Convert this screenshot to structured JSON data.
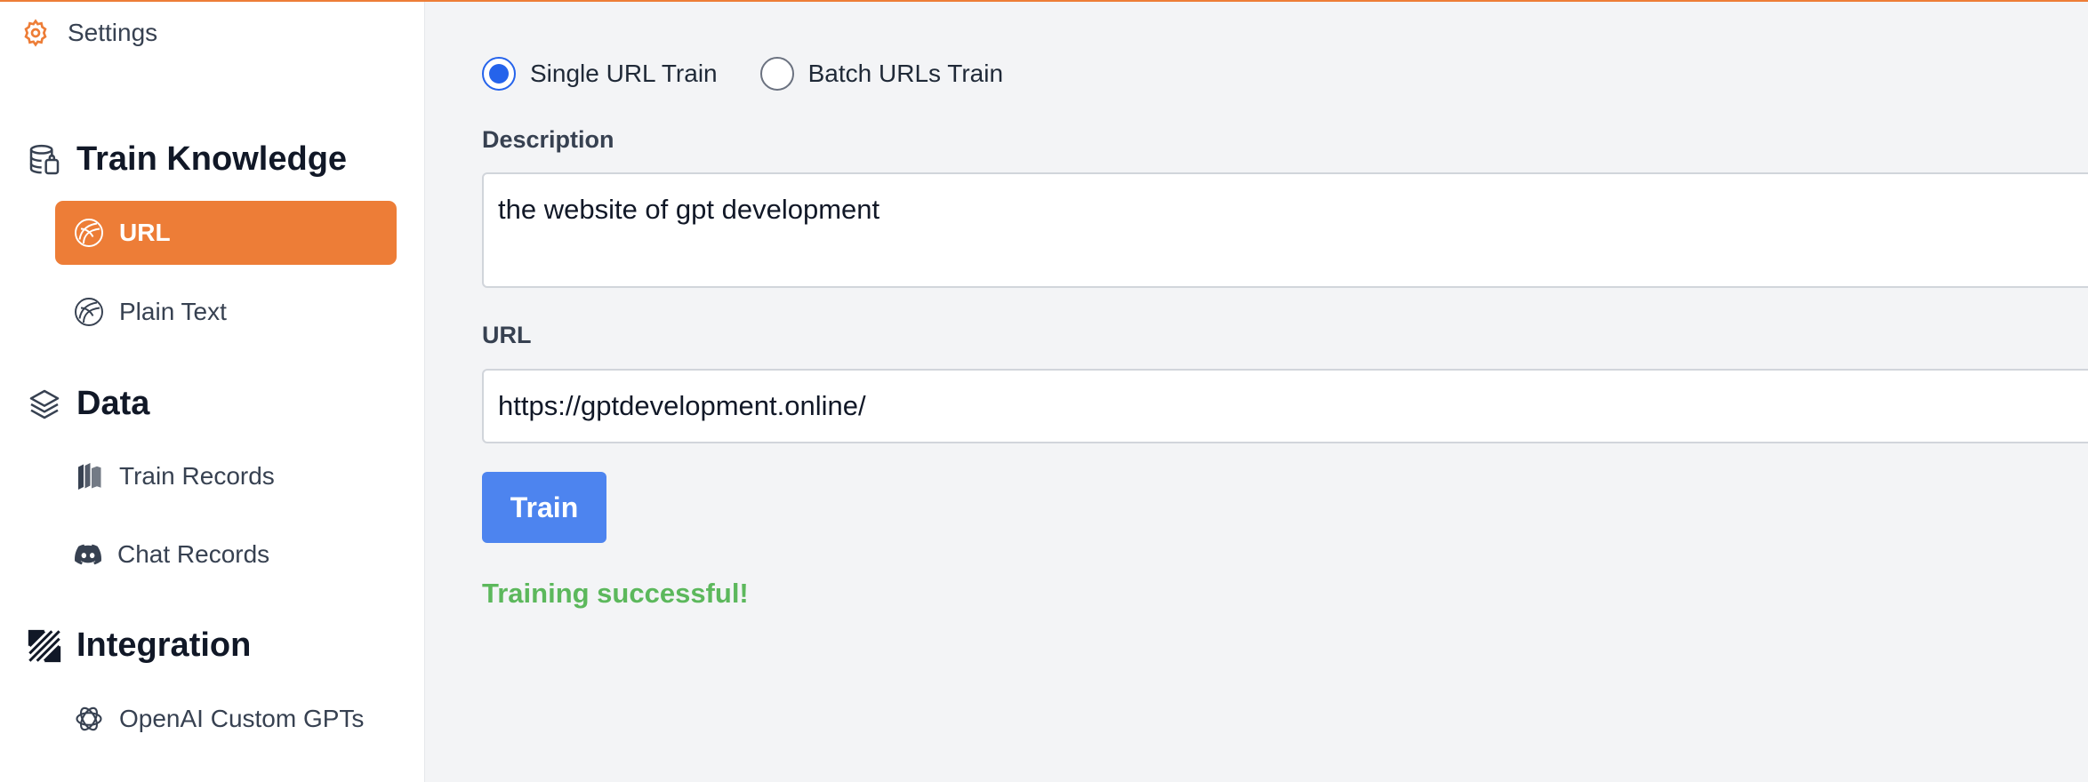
{
  "colors": {
    "accent": "#ed7d37",
    "primary": "#4d84ef",
    "success": "#5cb85c"
  },
  "sidebar": {
    "settings": {
      "label": "Settings",
      "icon": "gear-icon"
    },
    "sections": [
      {
        "title": "Train Knowledge",
        "icon": "database-icon",
        "items": [
          {
            "label": "URL",
            "icon": "globe-icon",
            "active": true
          },
          {
            "label": "Plain Text",
            "icon": "globe-icon",
            "active": false
          }
        ]
      },
      {
        "title": "Data",
        "icon": "layers-icon",
        "items": [
          {
            "label": "Train Records",
            "icon": "records-icon",
            "active": false
          },
          {
            "label": "Chat Records",
            "icon": "discord-icon",
            "active": false
          }
        ]
      },
      {
        "title": "Integration",
        "icon": "integration-icon",
        "items": [
          {
            "label": "OpenAI Custom GPTs",
            "icon": "openai-icon",
            "active": false
          }
        ]
      }
    ]
  },
  "main": {
    "mode_options": [
      {
        "label": "Single URL Train",
        "selected": true
      },
      {
        "label": "Batch URLs Train",
        "selected": false
      }
    ],
    "description": {
      "label": "Description",
      "value": "the website of gpt development"
    },
    "url": {
      "label": "URL",
      "value": "https://gptdevelopment.online/"
    },
    "train_button": "Train",
    "status_message": "Training successful!"
  }
}
